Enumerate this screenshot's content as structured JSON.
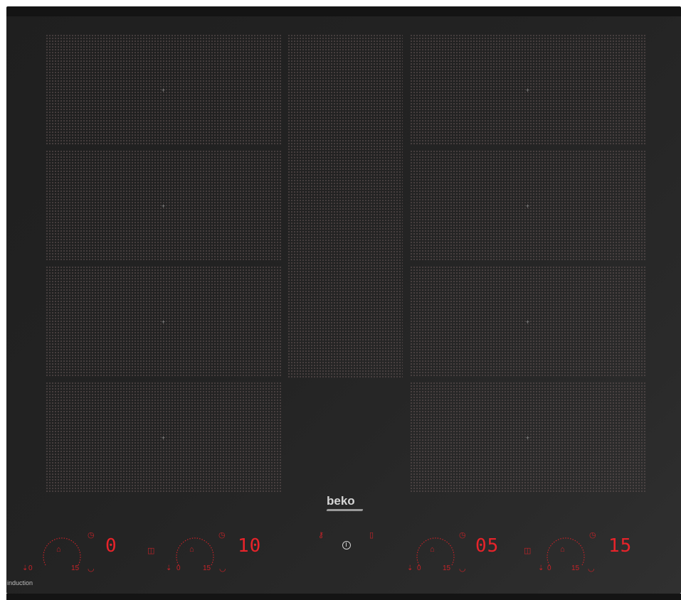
{
  "brand": {
    "logo": "beko",
    "label": "induction"
  },
  "controls": [
    {
      "id": "zone-1",
      "display": "0",
      "min": "0",
      "max": "15"
    },
    {
      "id": "zone-2",
      "display": "10",
      "min": "0",
      "max": "15"
    },
    {
      "id": "zone-3",
      "display": "05",
      "min": "0",
      "max": "15"
    },
    {
      "id": "zone-4",
      "display": "15",
      "min": "0",
      "max": "15"
    }
  ],
  "colors": {
    "accent": "#e8232a",
    "surface": "#222222"
  },
  "icons": {
    "power": "power-icon",
    "timer": "timer-icon",
    "lock": "lock-icon",
    "bridge": "bridge-icon",
    "pot": "pot-icon",
    "boost": "boost-icon"
  }
}
